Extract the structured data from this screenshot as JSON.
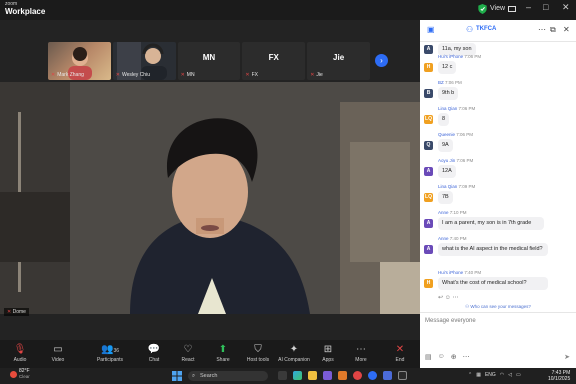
{
  "top": {
    "brand_small": "zoom",
    "brand_large": "Workplace",
    "view_label": "View"
  },
  "participants": [
    {
      "name": "Mark Zhang",
      "initials": ""
    },
    {
      "name": "Wesley Chiu",
      "initials": ""
    },
    {
      "name": "MN",
      "initials": "MN"
    },
    {
      "name": "FX",
      "initials": "FX"
    },
    {
      "name": "Jie",
      "initials": "Jie"
    }
  ],
  "self_name": "Dome",
  "toolbar": {
    "audio": "Audio",
    "video": "Video",
    "participants": "Participants",
    "participants_count": "36",
    "chat": "Chat",
    "react": "React",
    "share": "Share",
    "host_tools": "Host tools",
    "ai_companion": "AI Companion",
    "apps": "Apps",
    "more": "More",
    "end": "End"
  },
  "chat": {
    "recipient": "TKFCA",
    "who_can_see": "Who can see your messages?",
    "placeholder": "Message everyone",
    "messages": [
      {
        "sender": "",
        "time": "",
        "text": "11a, my son",
        "avatar": "A",
        "color": "#f0a020"
      },
      {
        "sender": "Hui's iPhone",
        "time": "7:06 PM",
        "text": "12 c",
        "avatar": "H",
        "color": "#f0a020"
      },
      {
        "sender": "BZ",
        "time": "7:06 PM",
        "text": "9th b",
        "avatar": "B",
        "color": "#3a4a6a"
      },
      {
        "sender": "Lina Qian",
        "time": "7:06 PM",
        "text": "8",
        "avatar": "LQ",
        "color": "#f0a020"
      },
      {
        "sender": "Queenie",
        "time": "7:06 PM",
        "text": "9A",
        "avatar": "Q",
        "color": "#3a4a6a"
      },
      {
        "sender": "Aoyu Jin",
        "time": "7:06 PM",
        "text": "12A",
        "avatar": "A",
        "color": "#6a4ab8"
      },
      {
        "sender": "Lina Qian",
        "time": "7:09 PM",
        "text": "7B",
        "avatar": "LQ",
        "color": "#f0a020"
      },
      {
        "sender": "Anne",
        "time": "7:10 PM",
        "text": "I am a parent, my son is in 7th grade",
        "avatar": "A",
        "color": "#6a4ab8"
      },
      {
        "sender": "Anne",
        "time": "7:40 PM",
        "text": "what is the AI aspect in the medical field?",
        "avatar": "A",
        "color": "#6a4ab8"
      },
      {
        "sender": "Hui's iPhone",
        "time": "7:40 PM",
        "text": "What's the cost of medical school?",
        "avatar": "H",
        "color": "#f0a020"
      }
    ]
  },
  "taskbar": {
    "temp": "82°F",
    "weather": "Clear",
    "search": "Search",
    "lang": "ENG",
    "time": "7:43 PM",
    "date": "10/1/2025"
  }
}
